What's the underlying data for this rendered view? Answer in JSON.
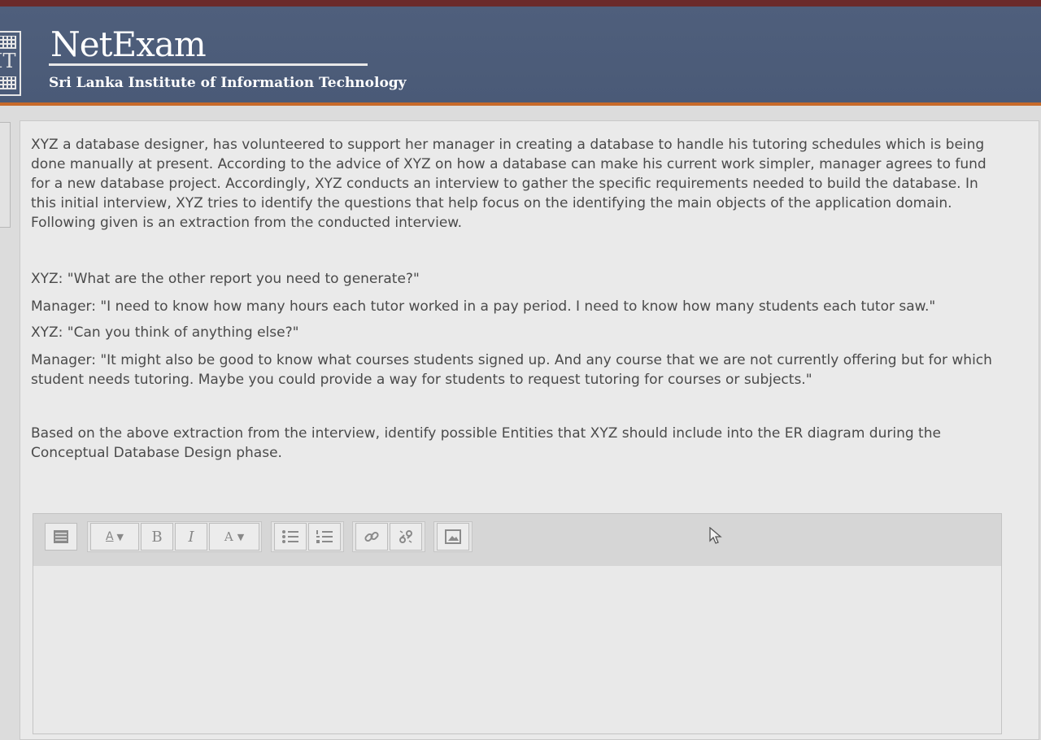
{
  "header": {
    "app_title": "NetExam",
    "institute": "Sri Lanka Institute of Information Technology",
    "logo_text": "IT"
  },
  "question": {
    "intro": "XYZ a database designer, has volunteered to support her manager in creating a database to handle his tutoring schedules which is being done manually at present. According to the advice of XYZ on how a database can make his current work simpler, manager agrees to fund for a new database project. Accordingly, XYZ conducts an interview to gather the specific requirements needed to build the database. In this initial interview, XYZ tries to identify the questions that help focus on the identifying the main objects of the application domain. Following given is an extraction from the conducted interview.",
    "dialogue": [
      "XYZ: \"What are the other report you need to generate?\"",
      "Manager: \"I need to know how many hours each tutor worked in a pay period. I need to know how many students each tutor saw.\"",
      "XYZ: \"Can you think of anything else?\"",
      "Manager: \"It might also be good to know what courses students signed up. And any course that we are not currently offering but for which student needs tutoring. Maybe you could provide a way for students to request tutoring for courses or subjects.\""
    ],
    "prompt": "Based on the above extraction from the interview, identify possible Entities that XYZ should include into the ER diagram during the Conceptual Database Design phase."
  },
  "editor": {
    "toolbar": {
      "toggle_icon": "toolbar-toggle-icon",
      "style_label": "A",
      "bold_label": "B",
      "italic_label": "I",
      "font_color_label": "A",
      "bullets_icon": "unordered-list-icon",
      "numbers_icon": "ordered-list-icon",
      "link_icon": "link-icon",
      "unlink_icon": "unlink-icon",
      "image_icon": "image-icon"
    },
    "answer_value": ""
  }
}
